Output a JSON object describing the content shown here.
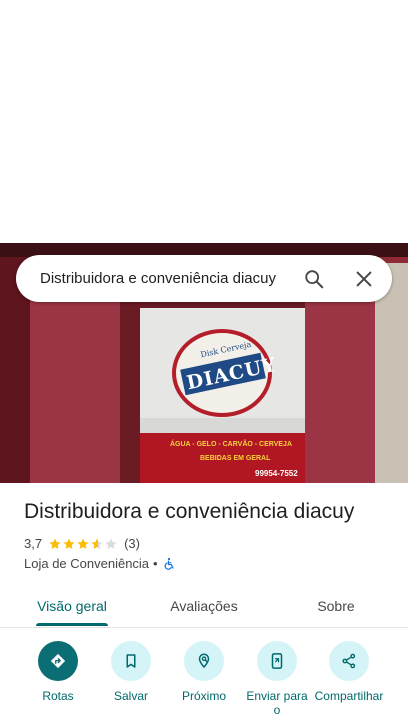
{
  "search": {
    "query": "Distribuidora e conveniência diacuy"
  },
  "photo": {
    "sign_top": "Disk Cerveja",
    "sign_brand": "DIACUY",
    "banner_line1": "ÁGUA - GELO - CARVÃO - CERVEJA",
    "banner_line2": "BEBIDAS EM GERAL",
    "phone": "99954-7552"
  },
  "place": {
    "title": "Distribuidora e conveniência diacuy",
    "rating": "3,7",
    "rating_value": 3.7,
    "reviews_count": "(3)",
    "category": "Loja de Conveniência",
    "separator": "•"
  },
  "tabs": [
    {
      "label": "Visão geral",
      "active": true
    },
    {
      "label": "Avaliações",
      "active": false
    },
    {
      "label": "Sobre",
      "active": false
    }
  ],
  "actions": [
    {
      "label": "Rotas",
      "icon": "directions-icon"
    },
    {
      "label": "Salvar",
      "icon": "bookmark-icon"
    },
    {
      "label": "Próximo",
      "icon": "nearby-icon"
    },
    {
      "label": "Enviar para o",
      "icon": "send-to-phone-icon"
    },
    {
      "label": "Compartilhar",
      "icon": "share-icon"
    }
  ],
  "colors": {
    "accent": "#00696b",
    "star": "#fbbc04",
    "chip_bg": "#d4f4f7",
    "primary_btn": "#0a6e74"
  }
}
